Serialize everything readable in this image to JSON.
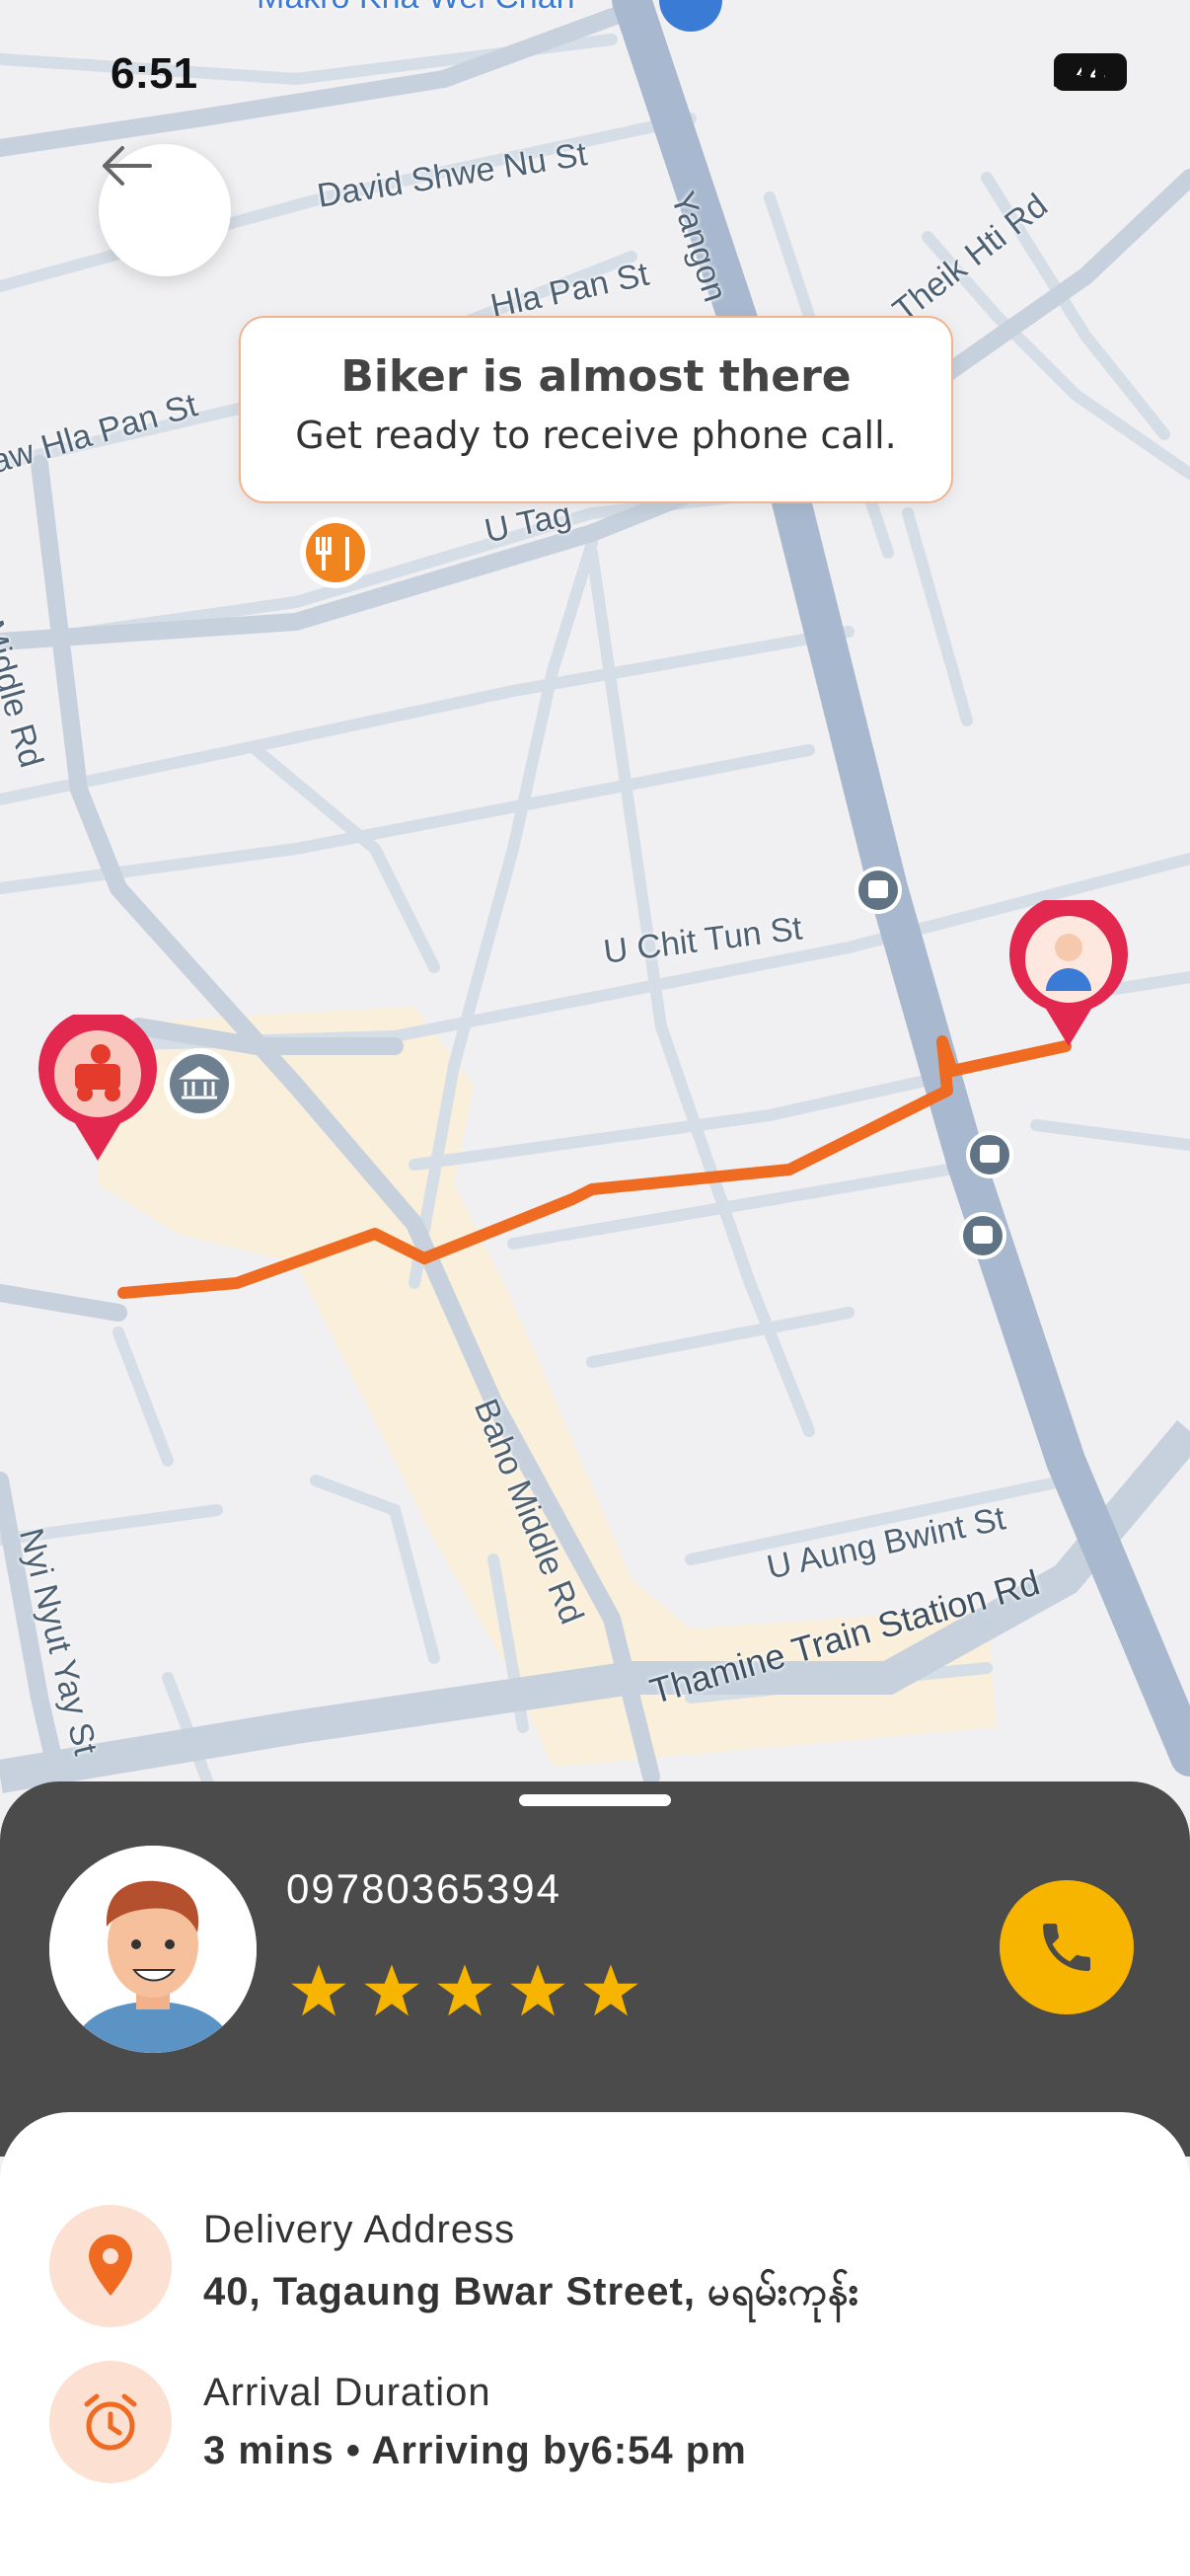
{
  "status_bar": {
    "time": "6:51",
    "battery": "44"
  },
  "map": {
    "road_labels": [
      "Makro Kha Wei Chan",
      "David Shwe Nu St",
      "Hla Pan St",
      "aw Hla Pan St",
      "Yangon",
      "Theik Hti Rd",
      "Middle Rd",
      "U Chit Tun St",
      "Baho Middle Rd",
      "U Aung Bwint St",
      "Nyi Nyut Yay St",
      "Thamine Train Station Rd",
      "U Tag"
    ]
  },
  "toast": {
    "title": "Biker is almost there",
    "subtitle": "Get ready to receive phone call."
  },
  "driver": {
    "phone": "09780365394",
    "rating": 5
  },
  "delivery": {
    "address_label": "Delivery Address",
    "address_value": "40, Tagaung Bwar Street, မရမ်းကုန်း",
    "duration_label": "Arrival Duration",
    "duration_value": "3 mins • Arriving by6:54 pm"
  },
  "colors": {
    "accent": "#f8b500",
    "route": "#f06b22",
    "pin": "#e3284f",
    "dark_sheet": "#4b4b4b",
    "icon_bg": "#fce0d1",
    "icon": "#f06b22"
  },
  "icons": {
    "back": "arrow-left-icon",
    "call": "phone-icon",
    "address": "location-pin-icon",
    "duration": "alarm-clock-icon",
    "restaurant": "fork-knife-icon",
    "bus": "bus-stop-icon",
    "bank": "bank-icon"
  }
}
